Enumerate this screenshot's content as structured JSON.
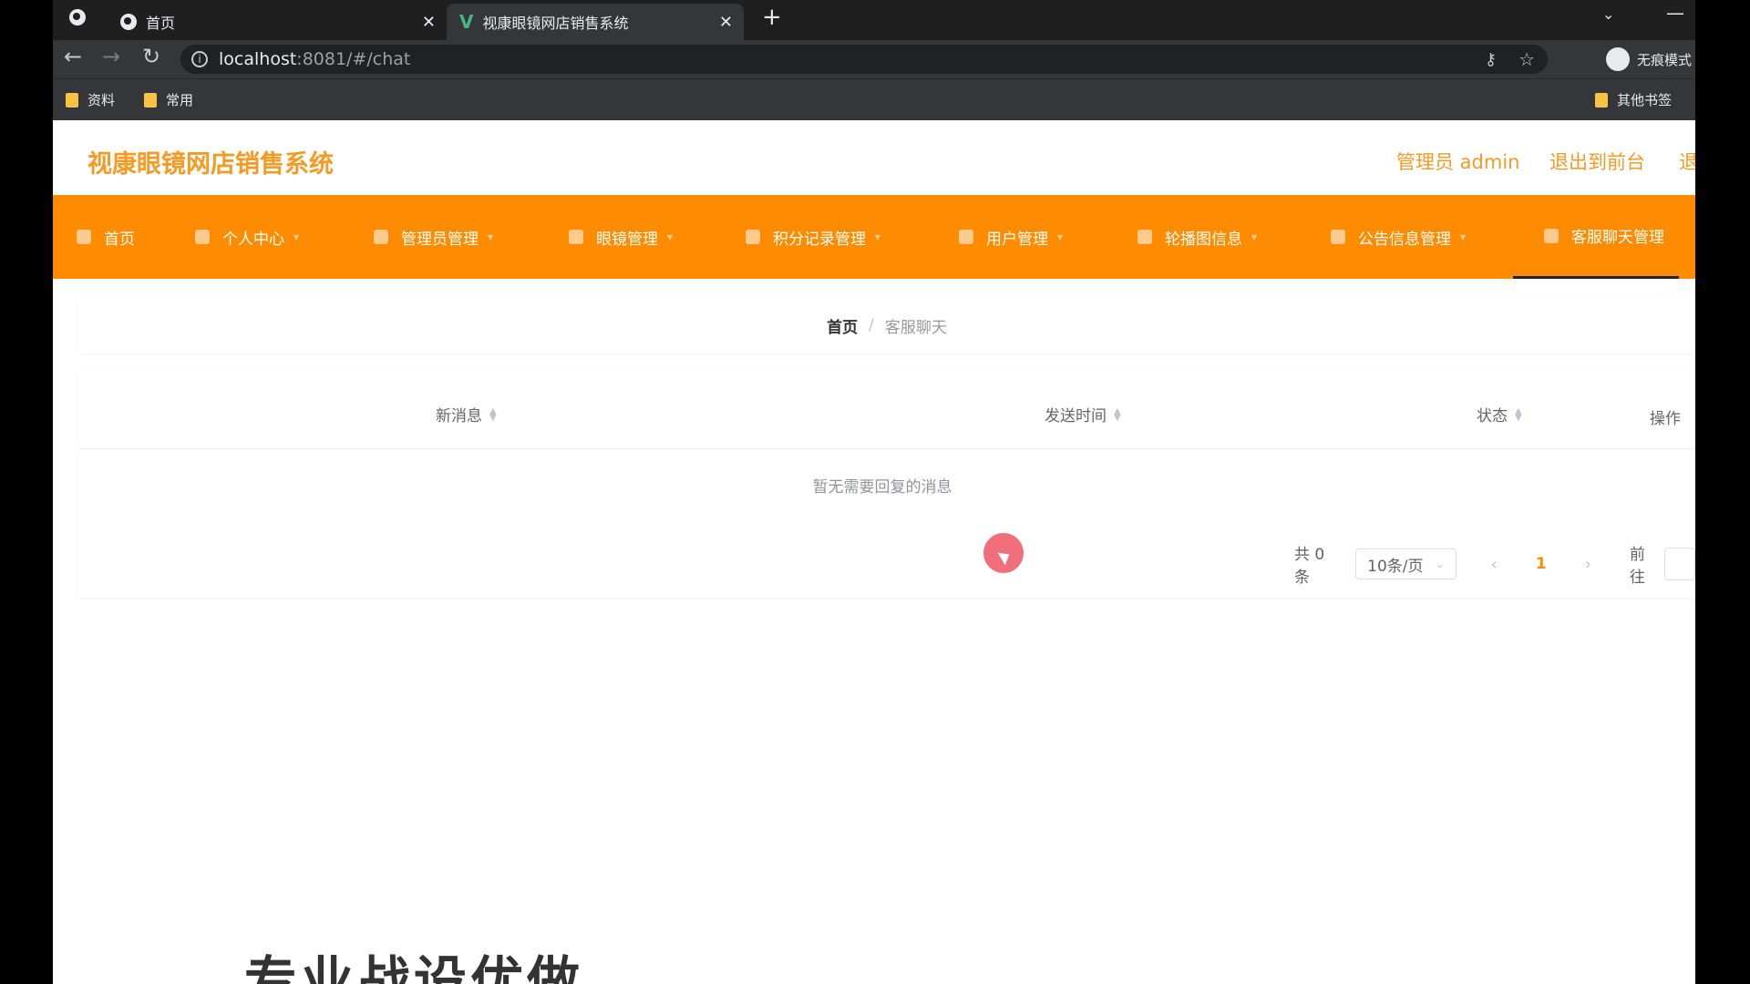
{
  "browser": {
    "tabs": [
      {
        "title": "首页",
        "active": false
      },
      {
        "title": "视康眼镜网店销售系统",
        "active": true
      }
    ],
    "new_tab": "+",
    "url_host": "localhost",
    "url_rest": ":8081/#/chat",
    "profile_label": "无痕模式",
    "bookmarks": [
      "资料",
      "常用"
    ],
    "other_bookmarks": "其他书签"
  },
  "app": {
    "brand": "视康眼镜网店销售系统",
    "user_label": "管理员 admin",
    "to_front": "退出到前台",
    "logout": "退"
  },
  "menu": [
    {
      "label": "首页",
      "dropdown": false
    },
    {
      "label": "个人中心",
      "dropdown": true
    },
    {
      "label": "管理员管理",
      "dropdown": true
    },
    {
      "label": "眼镜管理",
      "dropdown": true
    },
    {
      "label": "积分记录管理",
      "dropdown": true
    },
    {
      "label": "用户管理",
      "dropdown": true
    },
    {
      "label": "轮播图信息",
      "dropdown": true
    },
    {
      "label": "公告信息管理",
      "dropdown": true
    },
    {
      "label": "客服聊天管理",
      "dropdown": true,
      "active": true
    }
  ],
  "breadcrumb": {
    "home": "首页",
    "separator": "/",
    "current": "客服聊天"
  },
  "table": {
    "columns": [
      "新消息",
      "发送时间",
      "状态",
      "操作"
    ],
    "empty_text": "暂无需要回复的消息"
  },
  "pagination": {
    "total": "共 0 条",
    "page_size": "10条/页",
    "current_page": "1",
    "goto": "前往"
  },
  "footer_partial_text": "专业战设优做",
  "colors": {
    "accent": "#ff8c00",
    "brand_text": "#f59a23"
  }
}
